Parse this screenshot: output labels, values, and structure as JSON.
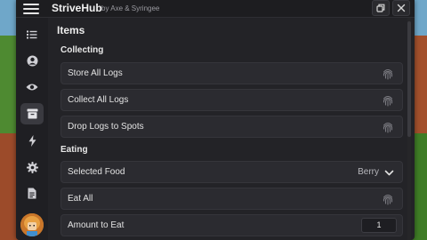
{
  "window": {
    "title": "StriveHub",
    "subtitle": "by Axe & Syringee"
  },
  "titlebar_buttons": [
    "restore-icon",
    "close-icon"
  ],
  "sidebar": {
    "items": [
      {
        "icon": "list-icon",
        "active": false
      },
      {
        "icon": "user-circle-icon",
        "active": false
      },
      {
        "icon": "eye-icon",
        "active": false
      },
      {
        "icon": "archive-box-icon",
        "active": true
      },
      {
        "icon": "lightning-icon",
        "active": false
      },
      {
        "icon": "gear-icon",
        "active": false
      },
      {
        "icon": "document-icon",
        "active": false
      }
    ],
    "avatar": "avatar"
  },
  "main": {
    "page_title": "Items",
    "sections": [
      {
        "label": "Collecting",
        "rows": [
          {
            "label": "Store All Logs",
            "type": "button",
            "icon": "fingerprint-icon"
          },
          {
            "label": "Collect All Logs",
            "type": "button",
            "icon": "fingerprint-icon"
          },
          {
            "label": "Drop Logs to Spots",
            "type": "button",
            "icon": "fingerprint-icon"
          }
        ]
      },
      {
        "label": "Eating",
        "rows": [
          {
            "label": "Selected Food",
            "type": "dropdown",
            "value": "Berry",
            "icon": "chevron-down-icon"
          },
          {
            "label": "Eat All",
            "type": "button",
            "icon": "fingerprint-icon"
          },
          {
            "label": "Amount to Eat",
            "type": "number",
            "value": "1"
          }
        ]
      }
    ]
  },
  "colors": {
    "window_bg": "#232327",
    "row_bg": "#2b2b30",
    "active_sidebar": "#3a3a40",
    "text": "#e2e2e2",
    "muted_text": "#9a9aa0"
  }
}
